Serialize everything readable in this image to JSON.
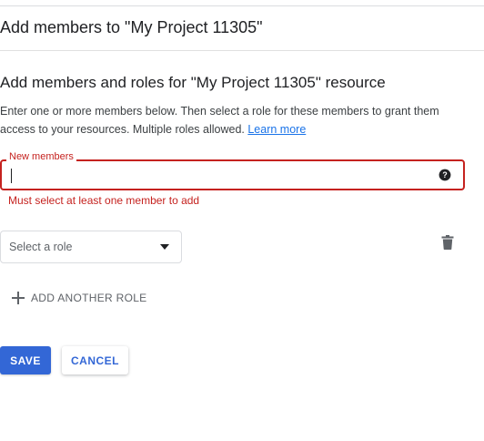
{
  "dialog": {
    "title": "Add members to \"My Project 11305\""
  },
  "section": {
    "heading": "Add members and roles for \"My Project 11305\" resource",
    "description": "Enter one or more members below. Then select a role for these members to grant them access to your resources. Multiple roles allowed. ",
    "learn_more": "Learn more"
  },
  "members_field": {
    "label": "New members",
    "value": "",
    "error": "Must select at least one member to add",
    "help_icon": "help-circle-icon"
  },
  "role": {
    "select_placeholder": "Select a role",
    "dropdown_icon": "arrow-drop-down-icon",
    "delete_icon": "trash-icon"
  },
  "add_role": {
    "label": "ADD ANOTHER ROLE",
    "icon": "plus-icon"
  },
  "actions": {
    "save_label": "SAVE",
    "cancel_label": "CANCEL"
  },
  "colors": {
    "error": "#c5221f",
    "primary": "#3367d6",
    "link": "#1a73e8"
  }
}
